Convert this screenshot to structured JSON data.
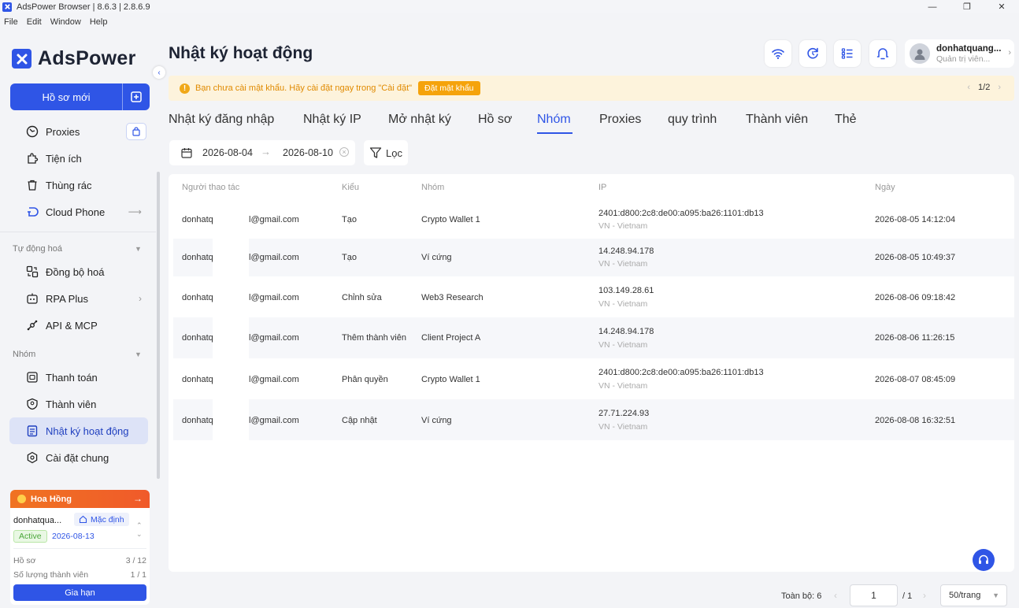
{
  "window": {
    "title": "AdsPower Browser | 8.6.3 | 2.8.6.9",
    "minimize": "—",
    "maximize": "❐",
    "close": "✕"
  },
  "menu": [
    "File",
    "Edit",
    "Window",
    "Help"
  ],
  "brand": {
    "name": "AdsPower",
    "accent": "#2f55e6"
  },
  "sidebar": {
    "new_profile": "Hồ sơ mới",
    "items_top": [
      {
        "label": "Proxies",
        "icon": "globe-icon"
      },
      {
        "label": "Tiện ích",
        "icon": "puzzle-icon"
      },
      {
        "label": "Thùng rác",
        "icon": "trash-icon"
      },
      {
        "label": "Cloud Phone",
        "icon": "cloud-phone-icon"
      }
    ],
    "section_automation": "Tự động hoá",
    "items_automation": [
      {
        "label": "Đồng bộ hoá",
        "icon": "sync-icon"
      },
      {
        "label": "RPA Plus",
        "icon": "robot-icon"
      },
      {
        "label": "API & MCP",
        "icon": "api-icon"
      }
    ],
    "section_team": "Nhóm",
    "items_team": [
      {
        "label": "Thanh toán",
        "icon": "billing-icon"
      },
      {
        "label": "Thành viên",
        "icon": "member-icon"
      },
      {
        "label": "Nhật ký hoạt động",
        "icon": "activity-log-icon",
        "active": true
      },
      {
        "label": "Cài đặt chung",
        "icon": "settings-icon"
      }
    ]
  },
  "commission": {
    "title": "Hoa Hồng",
    "arrow": "→",
    "user": "donhatqua...",
    "default_label": "Mặc định",
    "status": "Active",
    "date": "2026-08-13",
    "profiles_label": "Hồ sơ",
    "profiles_value": "3 / 12",
    "members_label": "Số lượng thành viên",
    "members_value": "1 / 1",
    "renew": "Gia hạn"
  },
  "header": {
    "title": "Nhật ký hoạt động",
    "user_name": "donhatquang...",
    "user_role": "Quản trị viên..."
  },
  "warning": {
    "text": "Bạn chưa cài mật khẩu. Hãy cài đặt ngay trong \"Cài đặt\"",
    "button": "Đặt mật khẩu",
    "page": "1/2"
  },
  "tabs": [
    "Nhật ký đăng nhập",
    "Nhật ký IP",
    "Mở nhật ký",
    "Hồ sơ",
    "Nhóm",
    "Proxies",
    "quy trình",
    "Thành viên",
    "Thẻ"
  ],
  "filter": {
    "date_from": "2026-08-04",
    "date_to": "2026-08-10",
    "filter_label": "Lọc"
  },
  "table": {
    "columns": [
      "Người thao tác",
      "Kiểu",
      "Nhóm",
      "IP",
      "Ngày"
    ],
    "rows": [
      {
        "op_a": "donhatq",
        "op_b": "l@gmail.com",
        "type": "Tạo",
        "group": "Crypto Wallet 1",
        "ip": "2401:d800:2c8:de00:a095:ba26:1101:db13",
        "loc": "VN - Vietnam",
        "date": "2026-08-05 14:12:04"
      },
      {
        "op_a": "donhatq",
        "op_b": "l@gmail.com",
        "type": "Tạo",
        "group": "Ví cứng",
        "ip": "14.248.94.178",
        "loc": "VN - Vietnam",
        "date": "2026-08-05 10:49:37"
      },
      {
        "op_a": "donhatq",
        "op_b": "l@gmail.com",
        "type": "Chỉnh sửa",
        "group": "Web3 Research",
        "ip": "103.149.28.61",
        "loc": "VN - Vietnam",
        "date": "2026-08-06 09:18:42"
      },
      {
        "op_a": "donhatq",
        "op_b": "l@gmail.com",
        "type": "Thêm thành viên",
        "group": "Client Project A",
        "ip": "14.248.94.178",
        "loc": "VN - Vietnam",
        "date": "2026-08-06 11:26:15"
      },
      {
        "op_a": "donhatq",
        "op_b": "l@gmail.com",
        "type": "Phân quyền",
        "group": "Crypto Wallet 1",
        "ip": "2401:d800:2c8:de00:a095:ba26:1101:db13",
        "loc": "VN - Vietnam",
        "date": "2026-08-07 08:45:09"
      },
      {
        "op_a": "donhatq",
        "op_b": "l@gmail.com",
        "type": "Cập nhật",
        "group": "Ví cứng",
        "ip": "27.71.224.93",
        "loc": "VN - Vietnam",
        "date": "2026-08-08 16:32:51"
      }
    ]
  },
  "pagination": {
    "total": "Toàn bộ: 6",
    "page": "1",
    "of": "/ 1",
    "size": "50/trang"
  }
}
